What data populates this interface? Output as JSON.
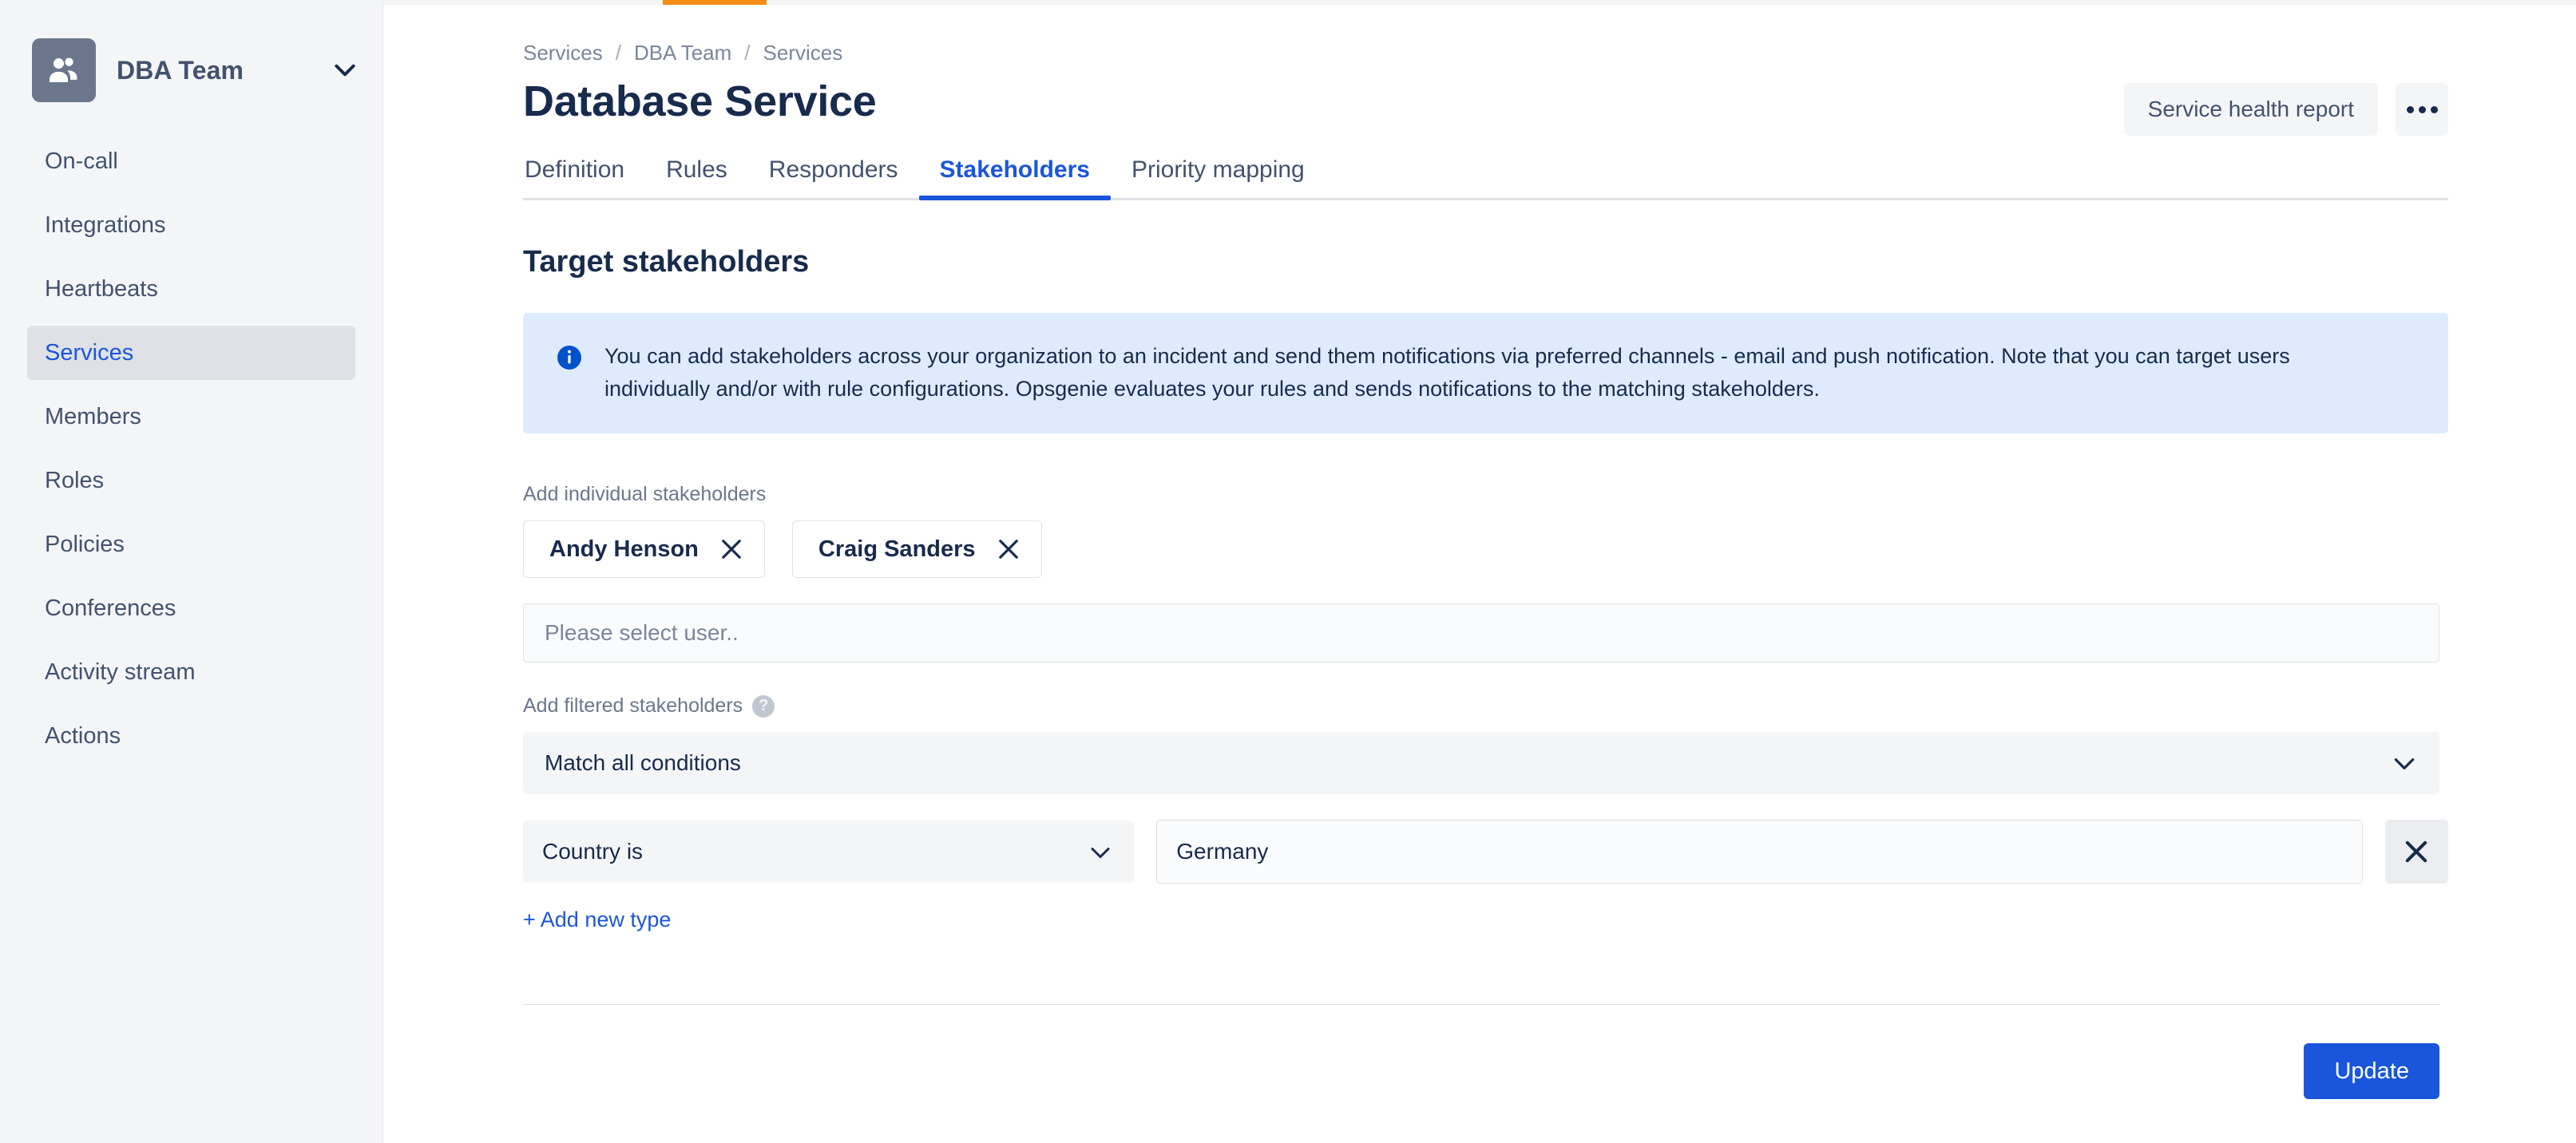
{
  "sidebar": {
    "team_name": "DBA Team",
    "team_avatar_icon": "people-icon",
    "team_chevron_icon": "chevron-down-icon",
    "items": [
      {
        "label": "On-call",
        "active": false
      },
      {
        "label": "Integrations",
        "active": false
      },
      {
        "label": "Heartbeats",
        "active": false
      },
      {
        "label": "Services",
        "active": true
      },
      {
        "label": "Members",
        "active": false
      },
      {
        "label": "Roles",
        "active": false
      },
      {
        "label": "Policies",
        "active": false
      },
      {
        "label": "Conferences",
        "active": false
      },
      {
        "label": "Activity stream",
        "active": false
      },
      {
        "label": "Actions",
        "active": false
      }
    ]
  },
  "header": {
    "breadcrumb": [
      "Services",
      "DBA Team",
      "Services"
    ],
    "breadcrumb_separator": "/",
    "page_title": "Database Service",
    "health_report_label": "Service health report",
    "more_icon": "ellipsis-icon"
  },
  "tabs": [
    {
      "label": "Definition",
      "active": false
    },
    {
      "label": "Rules",
      "active": false
    },
    {
      "label": "Responders",
      "active": false
    },
    {
      "label": "Stakeholders",
      "active": true
    },
    {
      "label": "Priority mapping",
      "active": false
    }
  ],
  "main": {
    "section_title": "Target stakeholders",
    "banner": {
      "icon": "info-icon",
      "text": "You can add stakeholders across your organization to an incident and send them notifications via preferred channels - email and push notification. Note that you can target users individually and/or with rule configurations. Opsgenie evaluates your rules and sends notifications to the matching stakeholders."
    },
    "individual_label": "Add individual stakeholders",
    "stakeholder_chips": [
      {
        "name": "Andy Henson",
        "remove_icon": "close-icon"
      },
      {
        "name": "Craig Sanders",
        "remove_icon": "close-icon"
      }
    ],
    "user_select": {
      "placeholder": "Please select user..",
      "value": ""
    },
    "filtered_label": "Add filtered stakeholders",
    "filtered_help_icon": "question-icon",
    "match_select": {
      "value": "Match all conditions",
      "chevron_icon": "chevron-down-icon"
    },
    "conditions": [
      {
        "type": "Country is",
        "type_chevron_icon": "chevron-down-icon",
        "value": "Germany",
        "remove_icon": "close-icon"
      }
    ],
    "add_type_label": "+ Add new type",
    "update_label": "Update"
  },
  "colors": {
    "accent_blue": "#1a56db",
    "banner_bg": "#deebff",
    "sidebar_bg": "#f4f5f7",
    "progress_orange": "#f18d13",
    "text_dark": "#172b4d",
    "text_muted": "#6b778c"
  }
}
